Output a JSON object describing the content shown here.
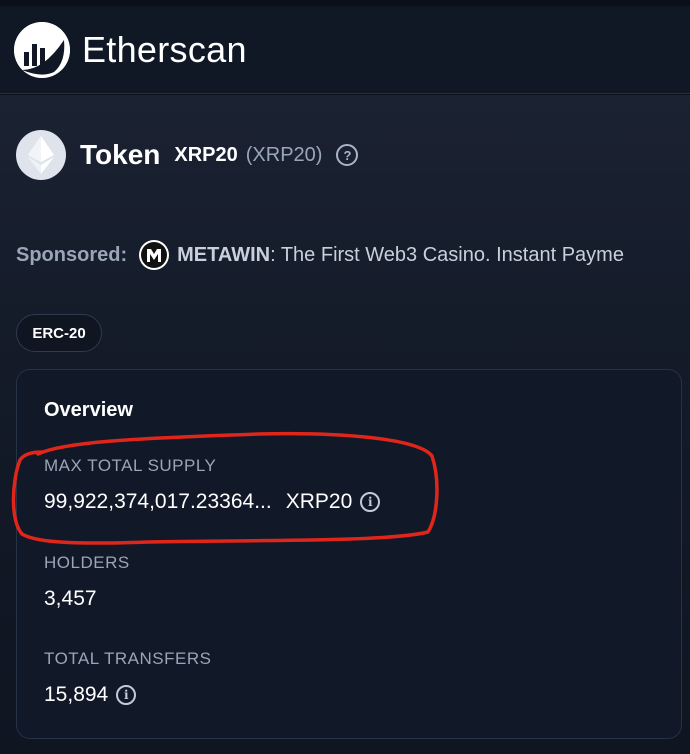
{
  "header": {
    "brand_name": "Etherscan",
    "logo_icon": "etherscan-logo-icon"
  },
  "token": {
    "title": "Token",
    "name": "XRP20",
    "symbol": "(XRP20)",
    "help_icon": "question-circle-icon",
    "help_glyph": "?"
  },
  "sponsored": {
    "label": "Sponsored:",
    "name": "METAWIN",
    "text": ": The First Web3 Casino. Instant Payme"
  },
  "badge": {
    "label": "ERC-20"
  },
  "overview": {
    "title": "Overview",
    "max_supply_label": "MAX TOTAL SUPPLY",
    "max_supply_value": "99,922,374,017.23364...",
    "max_supply_unit": "XRP20",
    "holders_label": "HOLDERS",
    "holders_value": "3,457",
    "transfers_label": "TOTAL TRANSFERS",
    "transfers_value": "15,894",
    "info_glyph": "i"
  },
  "colors": {
    "background": "#0b0f17",
    "card": "#111827",
    "muted_text": "#9aa5b6",
    "annotation": "#e0261b"
  }
}
